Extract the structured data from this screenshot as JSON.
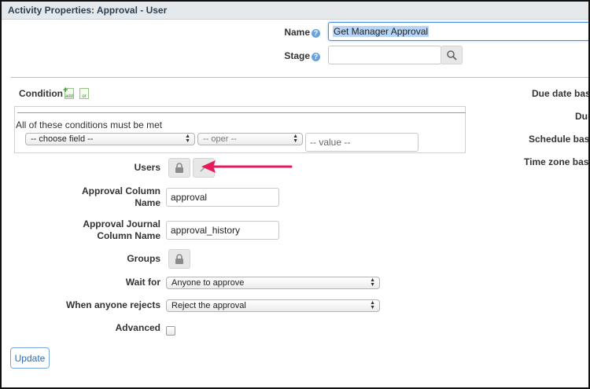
{
  "header": {
    "title": "Activity Properties: Approval - User"
  },
  "fields": {
    "name_label": "Name",
    "name_value": "Get Manager Approval",
    "stage_label": "Stage",
    "stage_value": ""
  },
  "condition": {
    "label": "Condition",
    "add_icon_label": "add",
    "or_icon_label": "or",
    "rule_text": "All of these conditions must be met",
    "field_select": "-- choose field --",
    "oper_select": "-- oper --",
    "value_placeholder": "-- value --"
  },
  "users": {
    "label": "Users"
  },
  "approval_column": {
    "label": "Approval Column Name",
    "value": "approval"
  },
  "approval_journal": {
    "label": "Approval Journal Column Name",
    "value": "approval_history"
  },
  "groups": {
    "label": "Groups"
  },
  "wait_for": {
    "label": "Wait for",
    "selected": "Anyone to approve"
  },
  "rejects": {
    "label": "When anyone rejects",
    "selected": "Reject the approval"
  },
  "advanced": {
    "label": "Advanced",
    "checked": false
  },
  "update_button": {
    "label": "Update"
  },
  "right_panel": {
    "due_date": "Due date bas",
    "dur": "Dur",
    "schedule": "Schedule bas",
    "timezone": "Time zone bas"
  },
  "colors": {
    "annotation_arrow": "#e8185a",
    "focus_border": "#4a8fd8",
    "selection": "#b6d5f7"
  }
}
